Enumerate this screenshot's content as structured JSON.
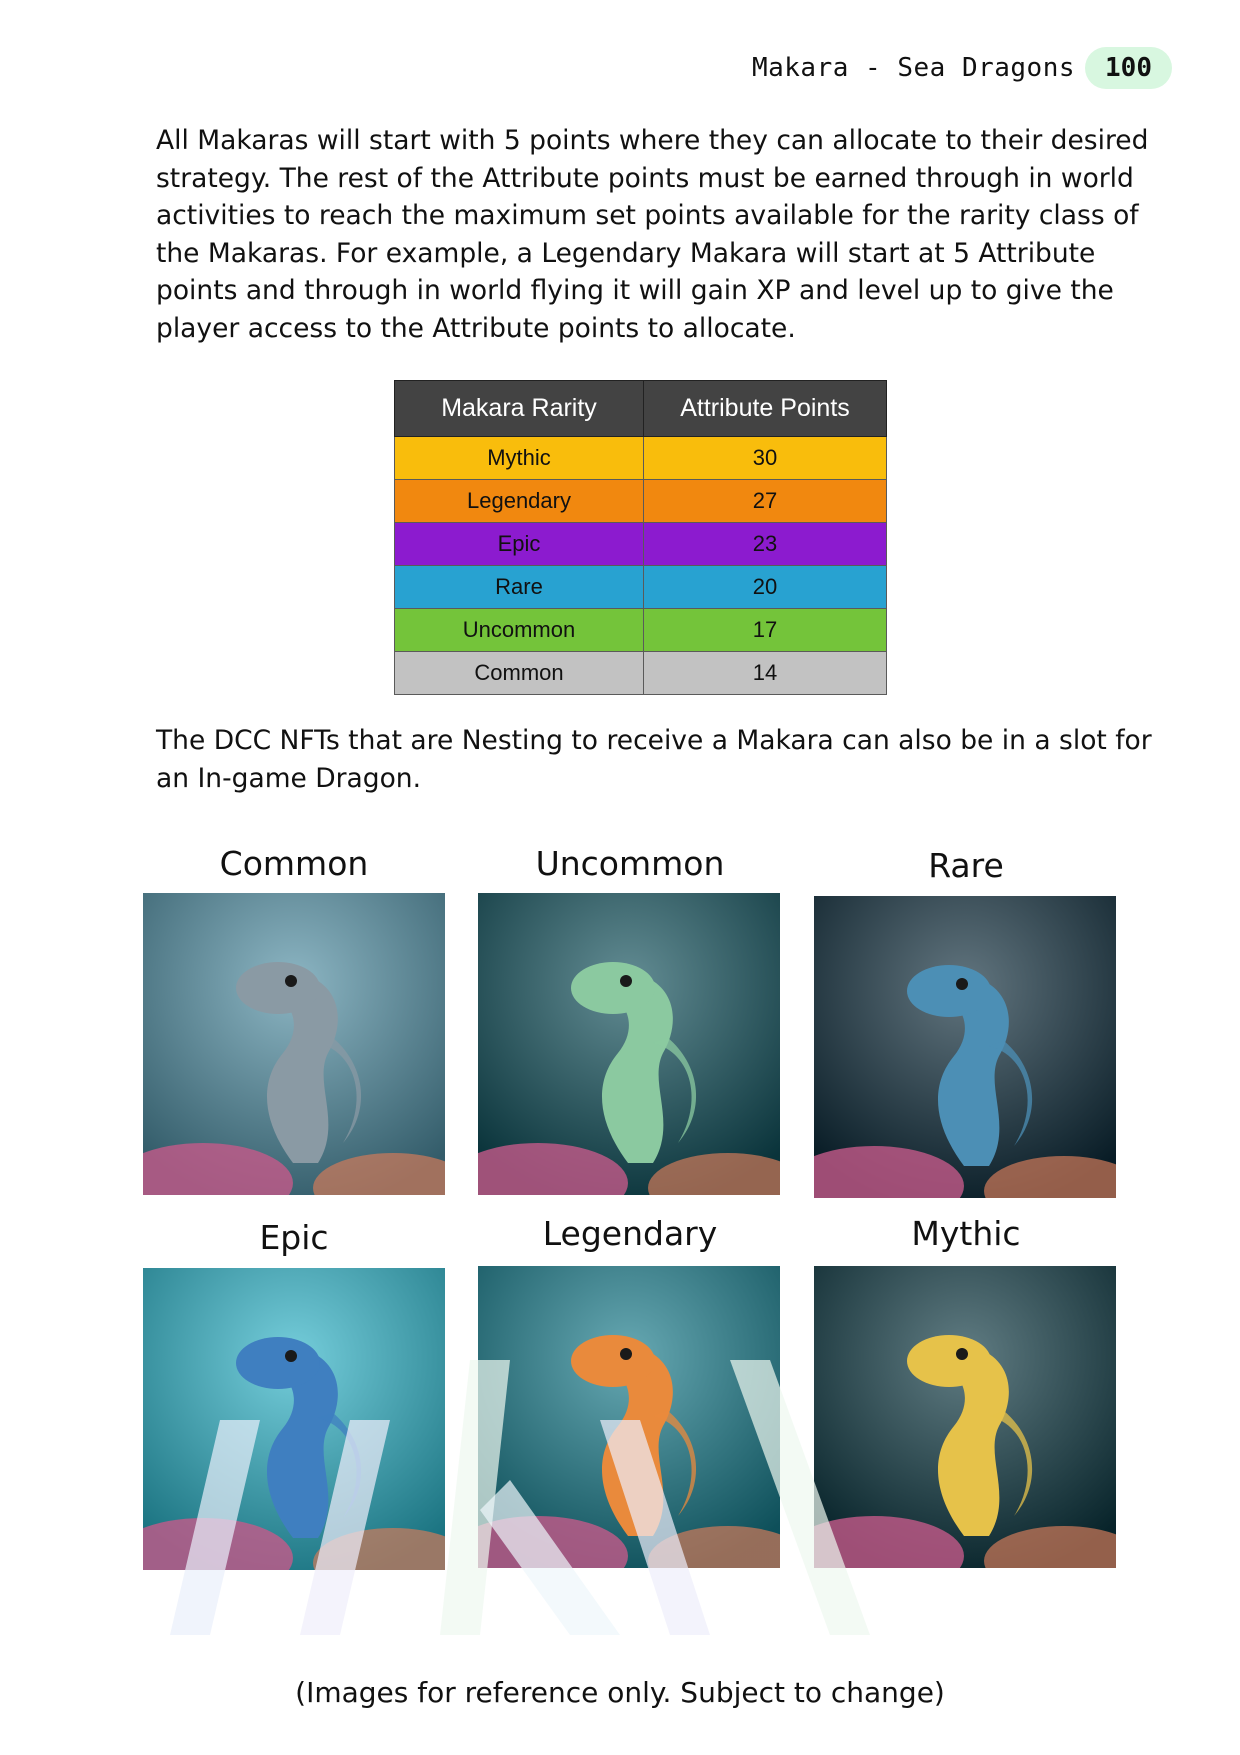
{
  "header": {
    "title": "Makara - Sea Dragons",
    "page_number": "100"
  },
  "intro_paragraph": "All Makaras will start with 5 points where they can allocate to their desired strategy. The rest of the Attribute points must be earned through in world activities to reach the maximum set points available for the rarity class of the Makaras. For example, a Legendary Makara will start at 5 Attribute points and through in world flying it will gain XP and level up to give the player access to the Attribute points to allocate.",
  "table": {
    "headers": [
      "Makara Rarity",
      "Attribute Points"
    ],
    "rows": [
      {
        "rarity": "Mythic",
        "points": "30",
        "color": "#f9bd0c"
      },
      {
        "rarity": "Legendary",
        "points": "27",
        "color": "#f1880f"
      },
      {
        "rarity": "Epic",
        "points": "23",
        "color": "#8c1bcf"
      },
      {
        "rarity": "Rare",
        "points": "20",
        "color": "#28a2d1"
      },
      {
        "rarity": "Uncommon",
        "points": "17",
        "color": "#74c43a"
      },
      {
        "rarity": "Common",
        "points": "14",
        "color": "#c2c2c2"
      }
    ]
  },
  "nesting_paragraph": "The DCC NFTs that are Nesting to receive a Makara can also be in a slot for an In-game Dragon.",
  "gallery": [
    {
      "label": "Common",
      "icon": "gray-sea-dragon-image",
      "bg": "#4f8ea3",
      "body": "#8a9aa4"
    },
    {
      "label": "Uncommon",
      "icon": "green-sea-dragon-image",
      "bg": "#0f4f5a",
      "body": "#8bc9a0"
    },
    {
      "label": "Rare",
      "icon": "blue-sea-dragon-image",
      "bg": "#0d2b3a",
      "body": "#4c8fb5"
    },
    {
      "label": "Epic",
      "icon": "blue-seahorse-dragon-image",
      "bg": "#2bb3c8",
      "body": "#3f7fc0"
    },
    {
      "label": "Legendary",
      "icon": "orange-seahorse-dragon-image",
      "bg": "#157a8a",
      "body": "#e98a3c"
    },
    {
      "label": "Mythic",
      "icon": "yellow-seahorse-dragon-image",
      "bg": "#0b3640",
      "body": "#e6c24a"
    }
  ],
  "caption": "(Images for reference only. Subject to change)"
}
